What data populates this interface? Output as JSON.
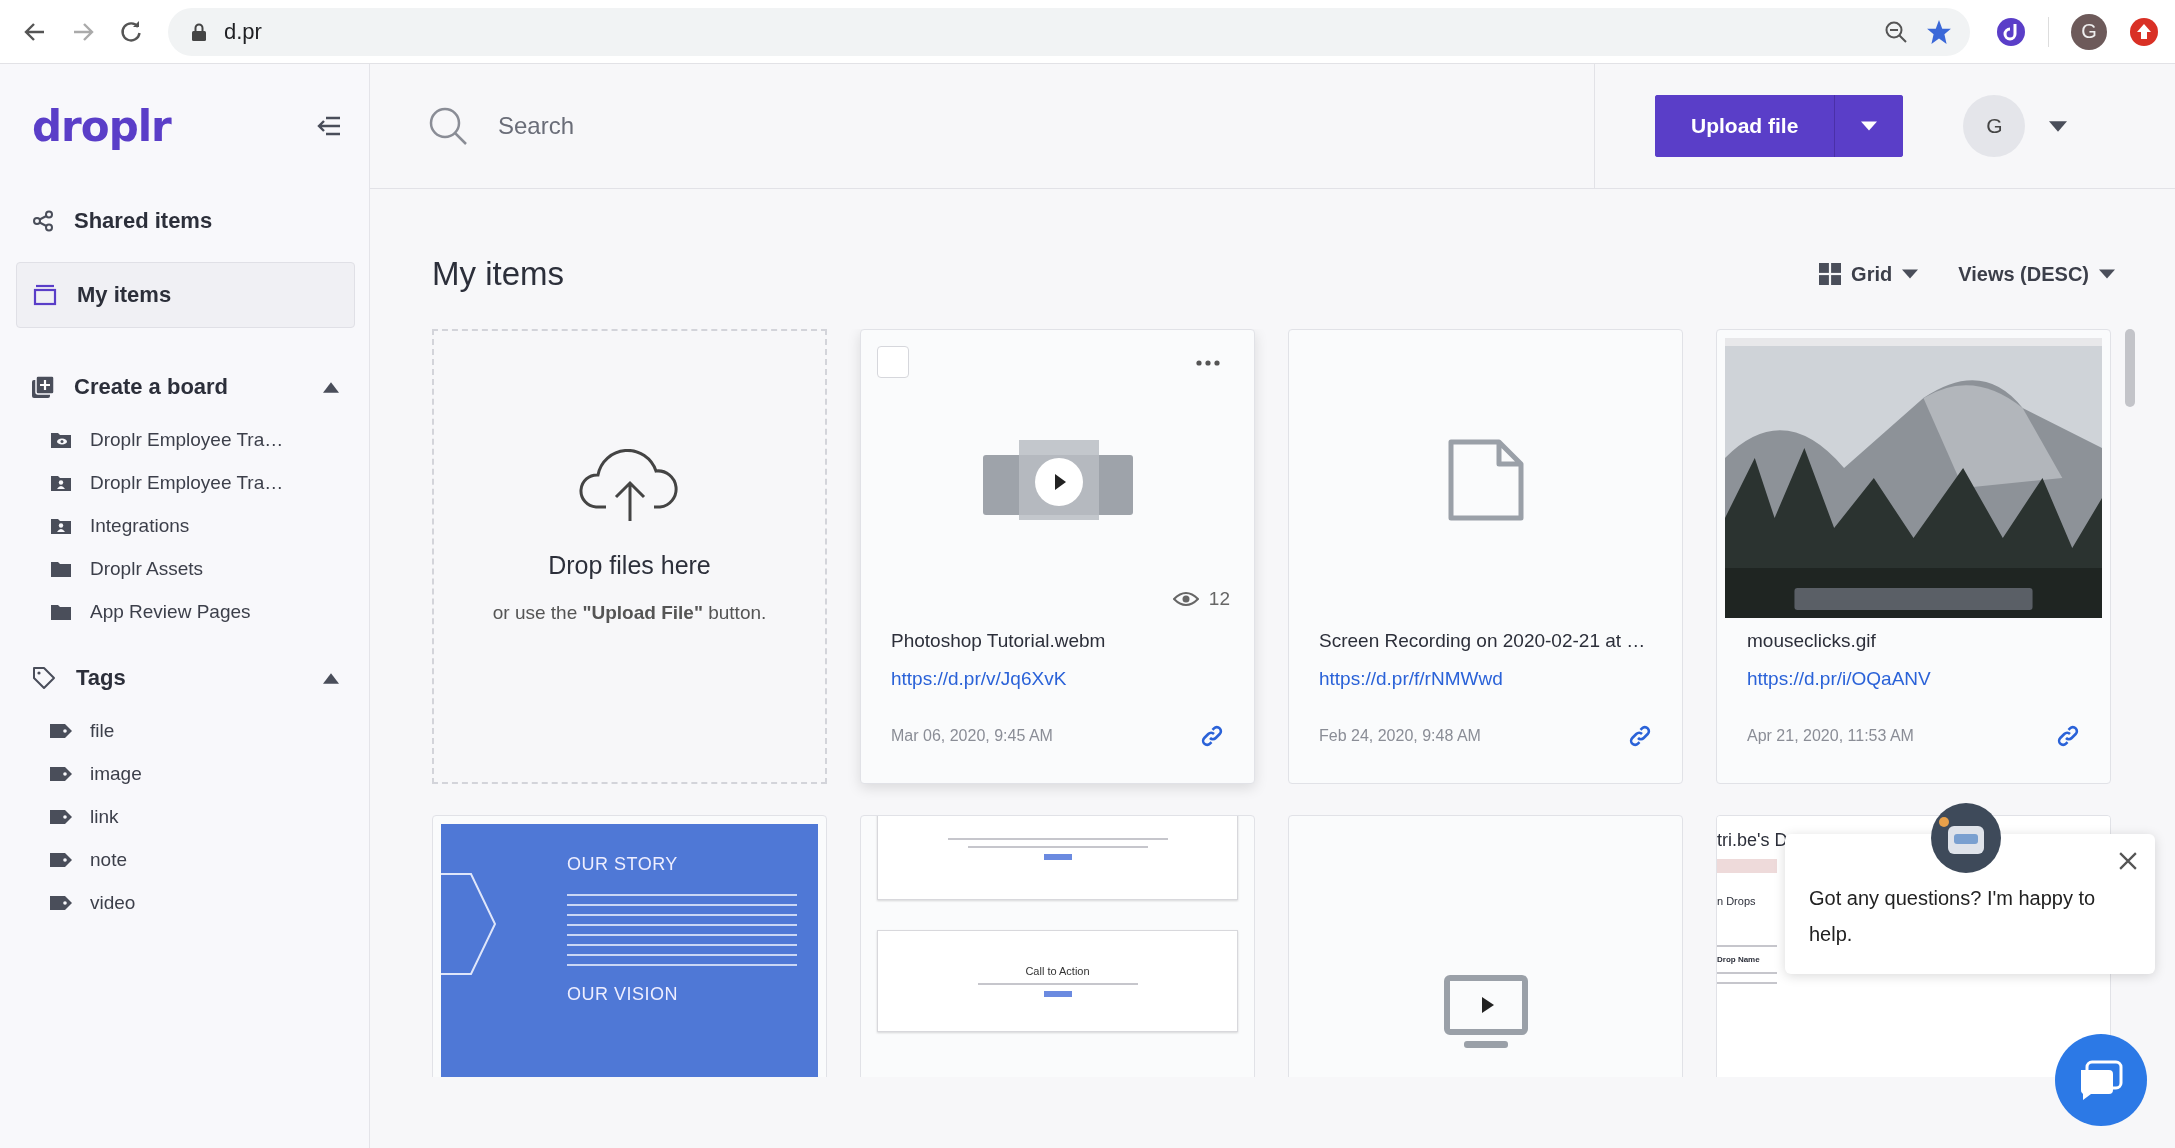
{
  "browser": {
    "url": "d.pr",
    "profile_letter": "G"
  },
  "sidebar": {
    "logo": "droplr",
    "nav": [
      {
        "label": "Shared items",
        "selected": false
      },
      {
        "label": "My items",
        "selected": true
      }
    ],
    "boards": {
      "title": "Create a board",
      "expanded": true,
      "items": [
        {
          "label": "Droplr Employee Tra…"
        },
        {
          "label": "Droplr Employee Tra…"
        },
        {
          "label": "Integrations"
        },
        {
          "label": "Droplr Assets"
        },
        {
          "label": "App Review Pages"
        }
      ]
    },
    "tags": {
      "title": "Tags",
      "expanded": true,
      "items": [
        "file",
        "image",
        "link",
        "note",
        "video"
      ]
    }
  },
  "header": {
    "search": {
      "placeholder": "Search"
    },
    "upload_button": "Upload file",
    "avatar": "G"
  },
  "main": {
    "title": "My items",
    "view": "Grid",
    "sort": "Views (DESC)",
    "drop_zone": {
      "title": "Drop files here",
      "hint": "or use the **\"Upload File\"** button."
    },
    "cards": [
      {
        "kind": "video",
        "checked": false,
        "views": "12",
        "name": "Photoshop Tutorial.webm",
        "link": "https://d.pr/v/Jq6XvK",
        "date": "Mar 06, 2020, 9:45 AM"
      },
      {
        "kind": "file",
        "name": "Screen Recording on 2020-02-21 at …",
        "link": "https://d.pr/f/rNMWwd",
        "date": "Feb 24, 2020, 9:48 AM"
      },
      {
        "name": "mouseclicks.gif",
        "link": "https://d.pr/i/OQaANV",
        "date": "Apr 21, 2020, 11:53 AM"
      },
      {
        "kind": "page-blue",
        "texts": [
          "OUR STORY",
          "OUR VISION"
        ]
      },
      {
        "kind": "page-cta",
        "texts": [
          "Call to Action"
        ]
      },
      {
        "kind": "media"
      },
      {
        "kind": "page-list",
        "texts": [
          "tri.be's D",
          "n Drops",
          "Drop Name"
        ]
      }
    ]
  },
  "chat": {
    "message": "Got any questions? I'm happy to help."
  }
}
